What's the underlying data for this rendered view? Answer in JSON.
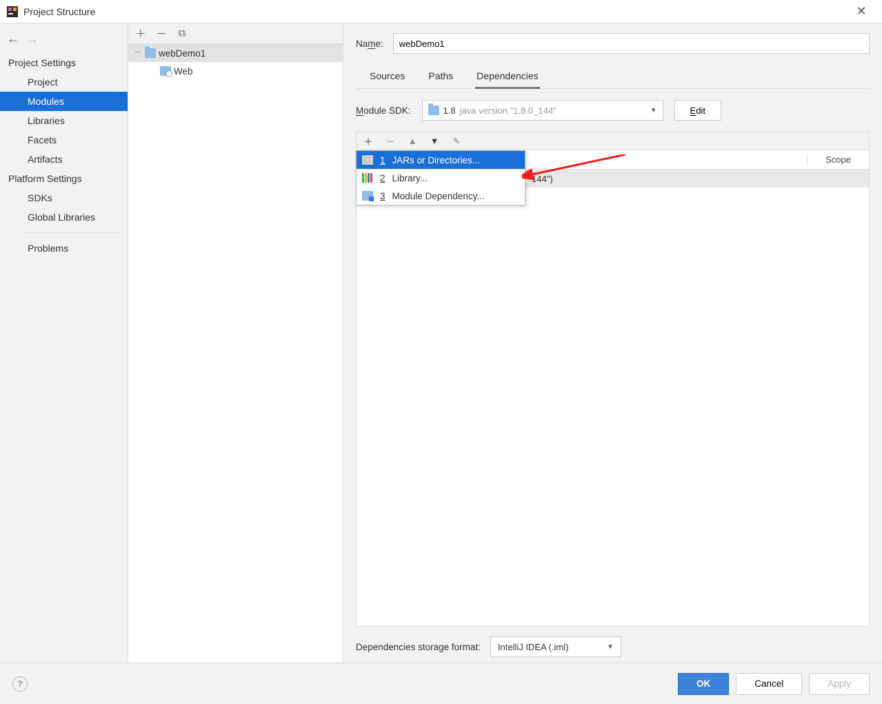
{
  "title": "Project Structure",
  "leftNav": {
    "section1": "Project Settings",
    "items1": [
      "Project",
      "Modules",
      "Libraries",
      "Facets",
      "Artifacts"
    ],
    "selected1": "Modules",
    "section2": "Platform Settings",
    "items2": [
      "SDKs",
      "Global Libraries"
    ],
    "problems": "Problems"
  },
  "tree": {
    "root": "webDemo1",
    "child": "Web"
  },
  "nameLabelPre": "Na",
  "nameLabelU": "m",
  "nameLabelPost": "e:",
  "nameValue": "webDemo1",
  "tabs": {
    "sources": "Sources",
    "paths": "Paths",
    "deps": "Dependencies"
  },
  "sdkLabelU": "M",
  "sdkLabelRest": "odule SDK:",
  "sdkVersion": "1.8",
  "sdkExtra": "java version \"1.8.0_144\"",
  "editU": "E",
  "editRest": "dit",
  "depsHeader": {
    "col1": "",
    "scope": "Scope"
  },
  "depsRowVisible": "144\")",
  "popup": {
    "i1": {
      "n": "1",
      "t": "JARs or Directories..."
    },
    "i2": {
      "n": "2",
      "t": "Library..."
    },
    "i3": {
      "n": "3",
      "t": "Module Dependency..."
    }
  },
  "storageLabel": "Dependencies storage format:",
  "storageValue": "IntelliJ IDEA (.iml)",
  "footer": {
    "ok": "OK",
    "cancel": "Cancel",
    "apply": "Apply"
  }
}
